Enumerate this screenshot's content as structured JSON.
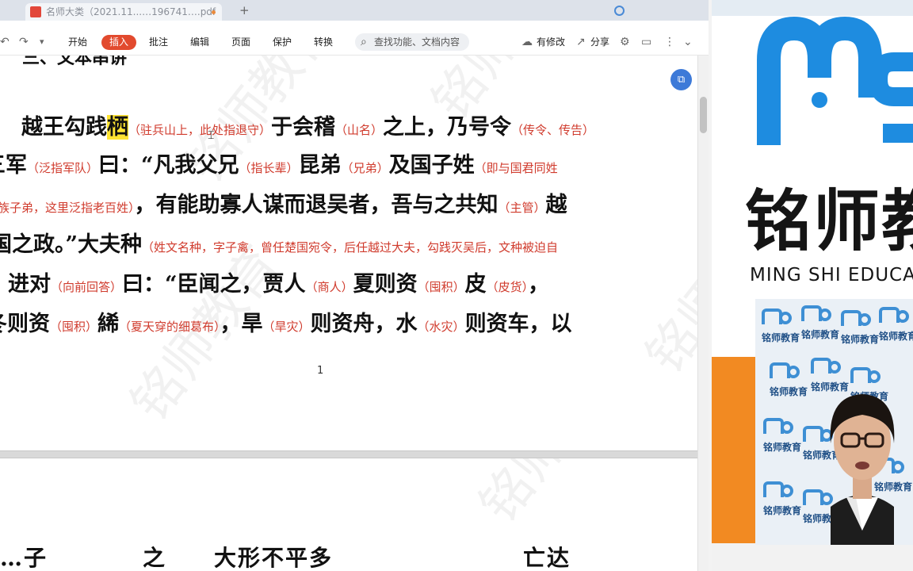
{
  "tabbar": {
    "document_tab": "名师大类（2021.11...…196741….pdf",
    "new_tab": "+"
  },
  "toolbar": {
    "undo": "↶",
    "redo": "↷",
    "more": "▾",
    "tabs": [
      "开始",
      "插入",
      "批注",
      "编辑",
      "页面",
      "保护",
      "转换"
    ],
    "search_placeholder": "查找功能、文档内容",
    "modified": "有修改",
    "share": "分享"
  },
  "document": {
    "heading_partial": "三、文本串讲",
    "lines": [
      {
        "segments": [
          {
            "text": "　越王勾践",
            "kind": "big"
          },
          {
            "text": "栖",
            "kind": "big-hl"
          },
          {
            "text": "（驻兵山上，此处指退守）",
            "kind": "note"
          },
          {
            "text": "于会稽",
            "kind": "big"
          },
          {
            "text": "（山名）",
            "kind": "note"
          },
          {
            "text": "之上，乃号令",
            "kind": "big"
          },
          {
            "text": "（传令、传告）",
            "kind": "note"
          }
        ]
      },
      {
        "segments": [
          {
            "text": "三军",
            "kind": "big"
          },
          {
            "text": "（泛指军队）",
            "kind": "note"
          },
          {
            "text": "曰：“凡我父兄",
            "kind": "big"
          },
          {
            "text": "（指长辈）",
            "kind": "note"
          },
          {
            "text": "昆弟",
            "kind": "big"
          },
          {
            "text": "（兄弟）",
            "kind": "note"
          },
          {
            "text": "及国子姓",
            "kind": "big"
          },
          {
            "text": "（即与国君同姓",
            "kind": "note"
          }
        ]
      },
      {
        "segments": [
          {
            "text": "贵族子弟，这里泛指老百姓）",
            "kind": "note"
          },
          {
            "text": "，有能助寡人谋而退吴者，吾与之共知",
            "kind": "big"
          },
          {
            "text": "（主管）",
            "kind": "note"
          },
          {
            "text": "越",
            "kind": "big"
          }
        ]
      },
      {
        "segments": [
          {
            "text": "国之政。”大夫种",
            "kind": "big"
          },
          {
            "text": "（姓文名种，字子禽，曾任楚国宛令，后任越过大夫，勾践灭吴后，文种被迫自",
            "kind": "note"
          }
        ]
      },
      {
        "segments": [
          {
            "text": "杀）",
            "kind": "note"
          },
          {
            "text": "进对",
            "kind": "big"
          },
          {
            "text": "（向前回答）",
            "kind": "note"
          },
          {
            "text": "曰：“臣闻之，贾人",
            "kind": "big"
          },
          {
            "text": "（商人）",
            "kind": "note"
          },
          {
            "text": "夏则资",
            "kind": "big"
          },
          {
            "text": "（囤积）",
            "kind": "note"
          },
          {
            "text": "皮",
            "kind": "big"
          },
          {
            "text": "（皮货）",
            "kind": "note"
          },
          {
            "text": "，",
            "kind": "big"
          }
        ]
      },
      {
        "segments": [
          {
            "text": "冬则资",
            "kind": "big"
          },
          {
            "text": "（囤积）",
            "kind": "note"
          },
          {
            "text": "絺",
            "kind": "big"
          },
          {
            "text": "（夏天穿的细葛布）",
            "kind": "note"
          },
          {
            "text": "，旱",
            "kind": "big"
          },
          {
            "text": "（旱灾）",
            "kind": "note"
          },
          {
            "text": "则资舟，水",
            "kind": "big"
          },
          {
            "text": "（水灾）",
            "kind": "note"
          },
          {
            "text": "则资车，以",
            "kind": "big"
          }
        ]
      }
    ],
    "page_number": "1",
    "next_page_partial": "…子　　　　之　　大形不平多　　　　　　　　亡达　　　　　　减对拒木子",
    "watermark_text": "铭师教育"
  },
  "brand": {
    "title": "铭师教",
    "subtitle": "MING SHI EDUCA",
    "backdrop_text": "铭师教育",
    "logo_color": "#1e8ce0",
    "accent_color": "#f28a22"
  },
  "colors": {
    "annotation": "#d03b2d",
    "highlight": "#ffe433",
    "insert_tab": "#e24a2e"
  }
}
